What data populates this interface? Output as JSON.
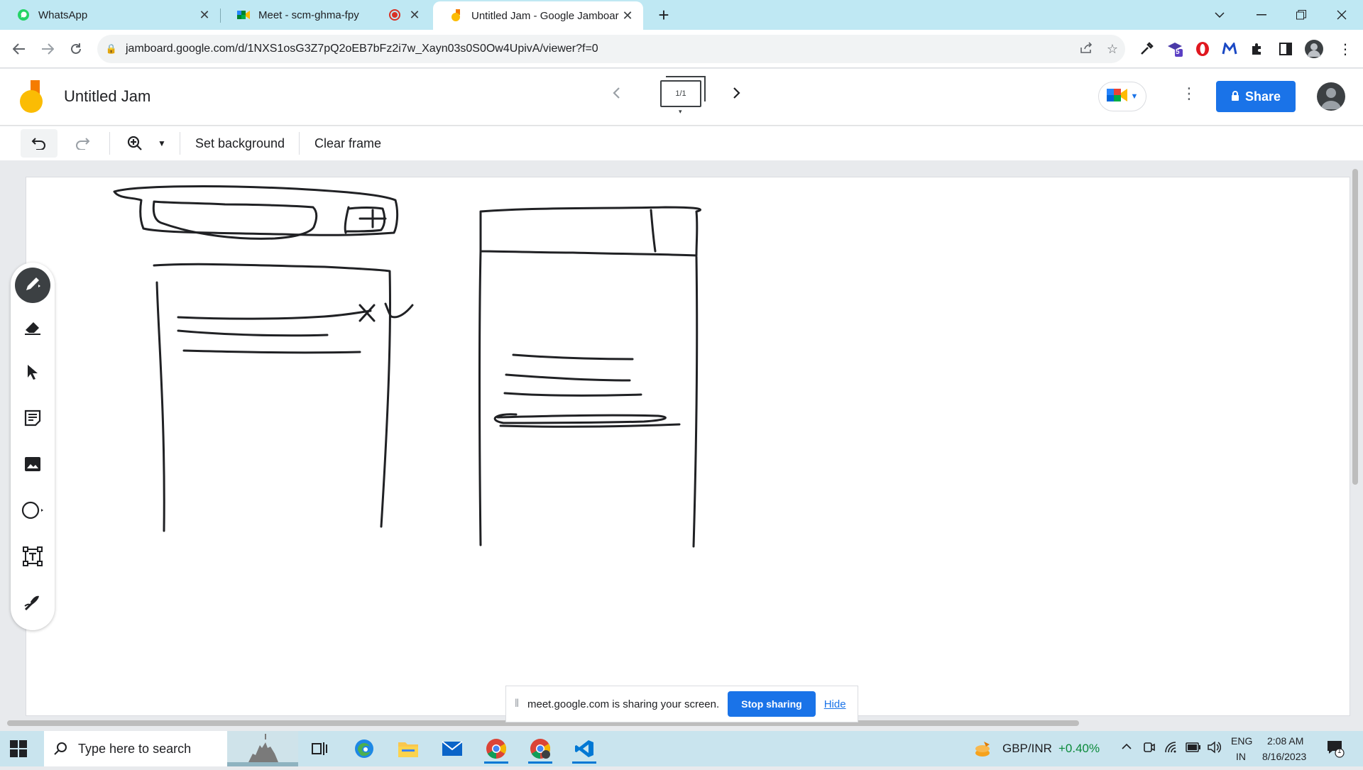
{
  "browser": {
    "tabs": [
      {
        "title": "WhatsApp",
        "icon": "whatsapp-icon"
      },
      {
        "title": "Meet - scm-ghma-fpy",
        "icon": "meet-icon"
      },
      {
        "title": "Untitled Jam - Google Jamboard",
        "icon": "jamboard-icon",
        "active": true
      }
    ],
    "url": "jamboard.google.com/d/1NXS1osG3Z7pQ2oEB7bFz2i7w_Xayn03s0S0Ow4UpivA/viewer?f=0",
    "extension_badge": "5"
  },
  "jam": {
    "title": "Untitled Jam",
    "frame_indicator": "1/1",
    "share_label": "Share",
    "toolbar": {
      "set_background": "Set background",
      "clear_frame": "Clear frame"
    },
    "tools": [
      "pen-tool",
      "eraser-tool",
      "select-tool",
      "sticky-note-tool",
      "image-tool",
      "circle-tool",
      "text-box-tool",
      "laser-tool"
    ]
  },
  "share_banner": {
    "message": "meet.google.com is sharing your screen.",
    "stop_label": "Stop sharing",
    "hide_label": "Hide"
  },
  "taskbar": {
    "search_placeholder": "Type here to search",
    "ticker": "GBP/INR",
    "ticker_change": "+0.40%",
    "lang_top": "ENG",
    "lang_bottom": "IN",
    "time": "2:08 AM",
    "date": "8/16/2023",
    "notification_count": "1"
  },
  "colors": {
    "accent": "#1a73e8",
    "tabstrip": "#bfe8f3",
    "ticker_positive": "#0b8a3a"
  }
}
